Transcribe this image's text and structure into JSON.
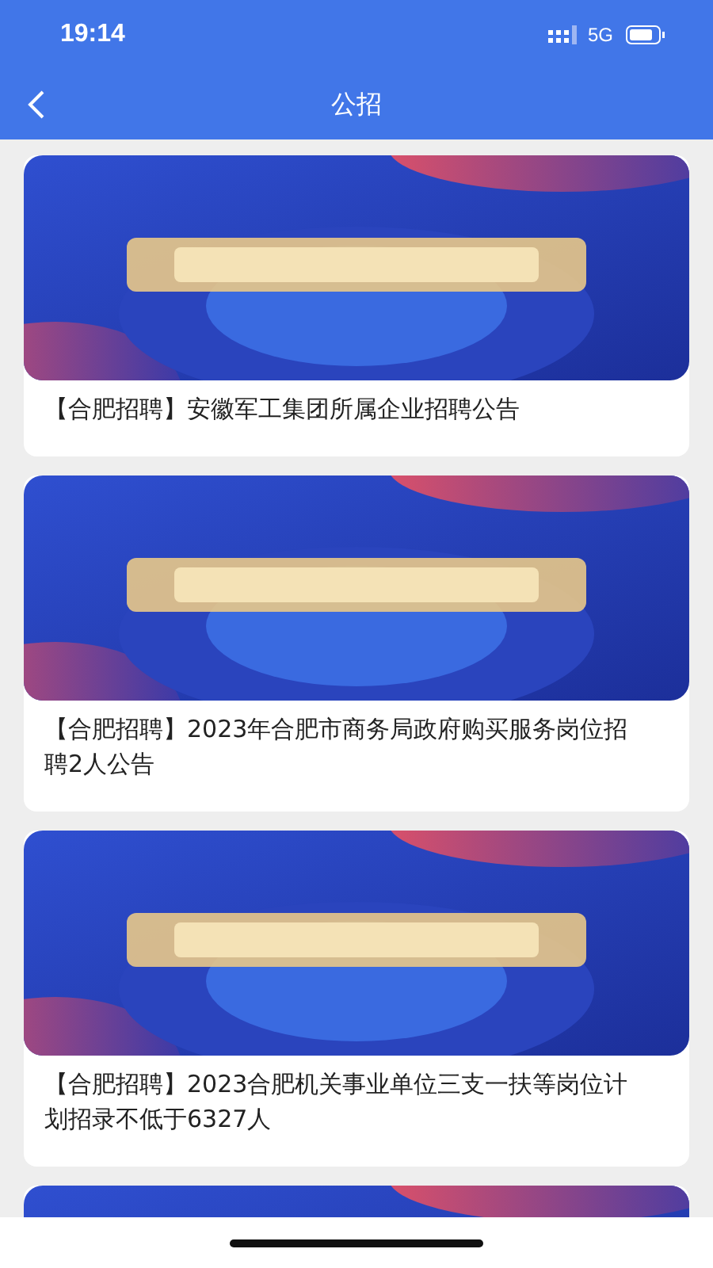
{
  "status_bar": {
    "time": "19:14",
    "network": "5G"
  },
  "nav_bar": {
    "title": "公招"
  },
  "articles": [
    {
      "kind": "picture",
      "title": "【合肥招聘】安徽军工集团所属企业招聘公告"
    },
    {
      "kind": "picture",
      "title": "【合肥招聘】2023年合肥市商务局政府购买服务岗位招聘2人公告"
    },
    {
      "kind": "picture",
      "title": "【合肥招聘】2023合肥机关事业单位三支一扶等岗位计划招录不低于6327人"
    },
    {
      "kind": "picture"
    }
  ]
}
